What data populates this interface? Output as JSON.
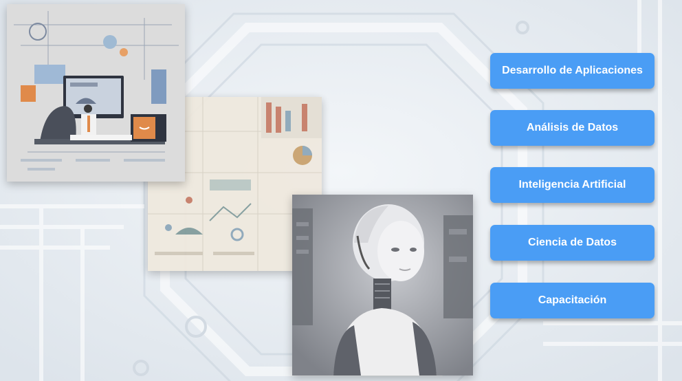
{
  "menu": {
    "items": [
      {
        "label": "Desarrollo de Aplicaciones"
      },
      {
        "label": "Análisis de Datos"
      },
      {
        "label": "Inteligencia Artificial"
      },
      {
        "label": "Ciencia de Datos"
      },
      {
        "label": "Capacitación"
      }
    ]
  },
  "colors": {
    "button": "#4a9df5",
    "button_text": "#ffffff",
    "background": "#e9eef3"
  },
  "images": [
    {
      "name": "app-development-illustration"
    },
    {
      "name": "data-analysis-illustration"
    },
    {
      "name": "artificial-intelligence-robot-illustration"
    }
  ]
}
